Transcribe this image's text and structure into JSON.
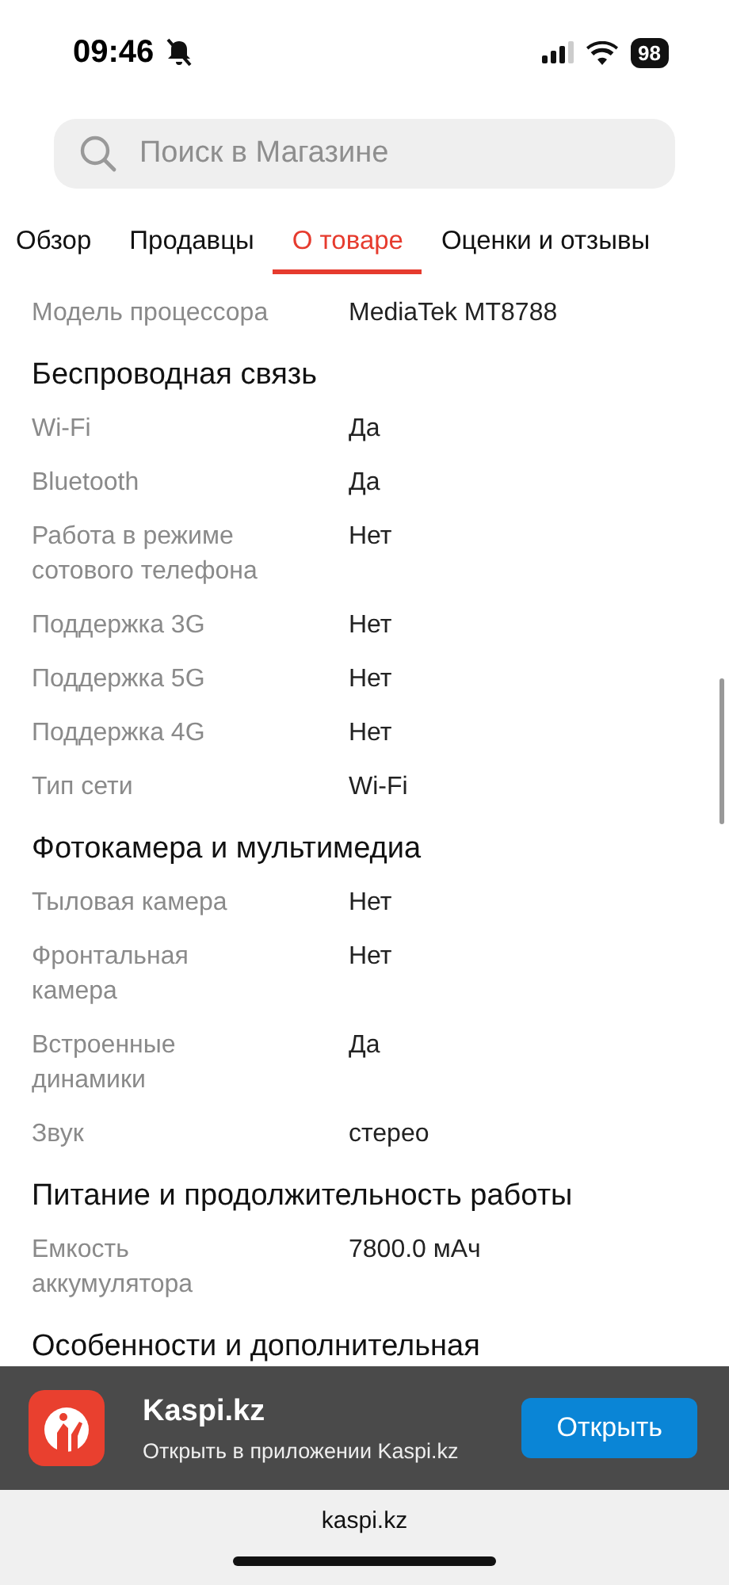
{
  "status_bar": {
    "time": "09:46",
    "battery": "98"
  },
  "search": {
    "placeholder": "Поиск в Магазине"
  },
  "tabs": [
    {
      "label": "Обзор",
      "selected": false
    },
    {
      "label": "Продавцы",
      "selected": false
    },
    {
      "label": "О товаре",
      "selected": true
    },
    {
      "label": "Оценки и отзывы",
      "selected": false
    }
  ],
  "sections": [
    {
      "rows": [
        {
          "label": "Модель процессора",
          "value": "MediaTek MT8788"
        }
      ]
    },
    {
      "title": "Беспроводная связь",
      "rows": [
        {
          "label": "Wi-Fi",
          "value": "Да"
        },
        {
          "label": "Bluetooth",
          "value": "Да"
        },
        {
          "label": "Работа в режиме сотового телефона",
          "value": "Нет"
        },
        {
          "label": "Поддержка 3G",
          "value": "Нет"
        },
        {
          "label": "Поддержка 5G",
          "value": "Нет"
        },
        {
          "label": "Поддержка 4G",
          "value": "Нет"
        },
        {
          "label": "Тип сети",
          "value": "Wi-Fi"
        }
      ]
    },
    {
      "title": "Фотокамера и мультимедиа",
      "rows": [
        {
          "label": "Тыловая камера",
          "value": "Нет"
        },
        {
          "label": "Фронтальная камера",
          "value": "Нет"
        },
        {
          "label": "Встроенные динамики",
          "value": "Да"
        },
        {
          "label": "Звук",
          "value": "стерео"
        }
      ]
    },
    {
      "title": "Питание и продолжительность работы",
      "rows": [
        {
          "label": "Емкость аккумулятора",
          "value": "7800.0 мАч"
        }
      ]
    },
    {
      "title": "Особенности и дополнительная"
    }
  ],
  "app_banner": {
    "name": "Kaspi.kz",
    "subtitle": "Открыть в приложении Kaspi.kz",
    "button": "Открыть"
  },
  "address_bar": {
    "url": "kaspi.kz"
  }
}
